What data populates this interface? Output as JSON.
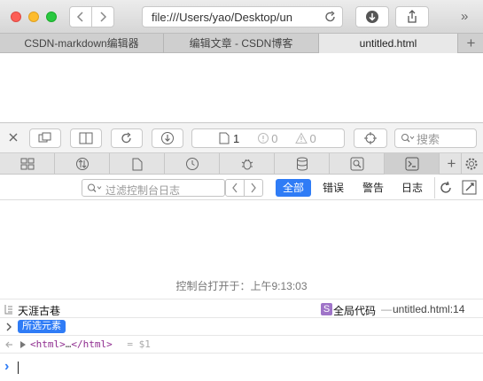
{
  "window": {
    "url": "file:///Users/yao/Desktop/un",
    "overflow_label": "»"
  },
  "tabs": [
    {
      "label": "CSDN-markdown编辑器",
      "active": false
    },
    {
      "label": "编辑文章 - CSDN博客",
      "active": false
    },
    {
      "label": "untitled.html",
      "active": true
    }
  ],
  "new_tab_label": "+",
  "inspector": {
    "page_count": "1",
    "error_count": "0",
    "warning_count": "0",
    "search_placeholder": "搜索",
    "filter_placeholder": "过滤控制台日志",
    "levels": [
      {
        "label": "全部",
        "active": true
      },
      {
        "label": "错误",
        "active": false
      },
      {
        "label": "警告",
        "active": false
      },
      {
        "label": "日志",
        "active": false
      }
    ]
  },
  "console": {
    "opened_message": "控制台打开于：上午9:13:03",
    "log_message": "天涯古巷",
    "log_source_badge": "S",
    "log_source_scope": "全局代码",
    "log_source_sep": "—",
    "log_source_file": "untitled.html:14",
    "selected_element_badge": "所选元素",
    "html_open": "<html>",
    "html_ellipsis": "…",
    "html_close": "</html>",
    "html_result": "= $1",
    "prompt_symbol": "›"
  },
  "colors": {
    "accent": "#2f7cf6",
    "red_light": "#fc5f57",
    "yellow_light": "#fdbc2e",
    "green_light": "#29c840",
    "tag_purple": "#8e2b8e",
    "source_badge": "#9f74c8"
  }
}
